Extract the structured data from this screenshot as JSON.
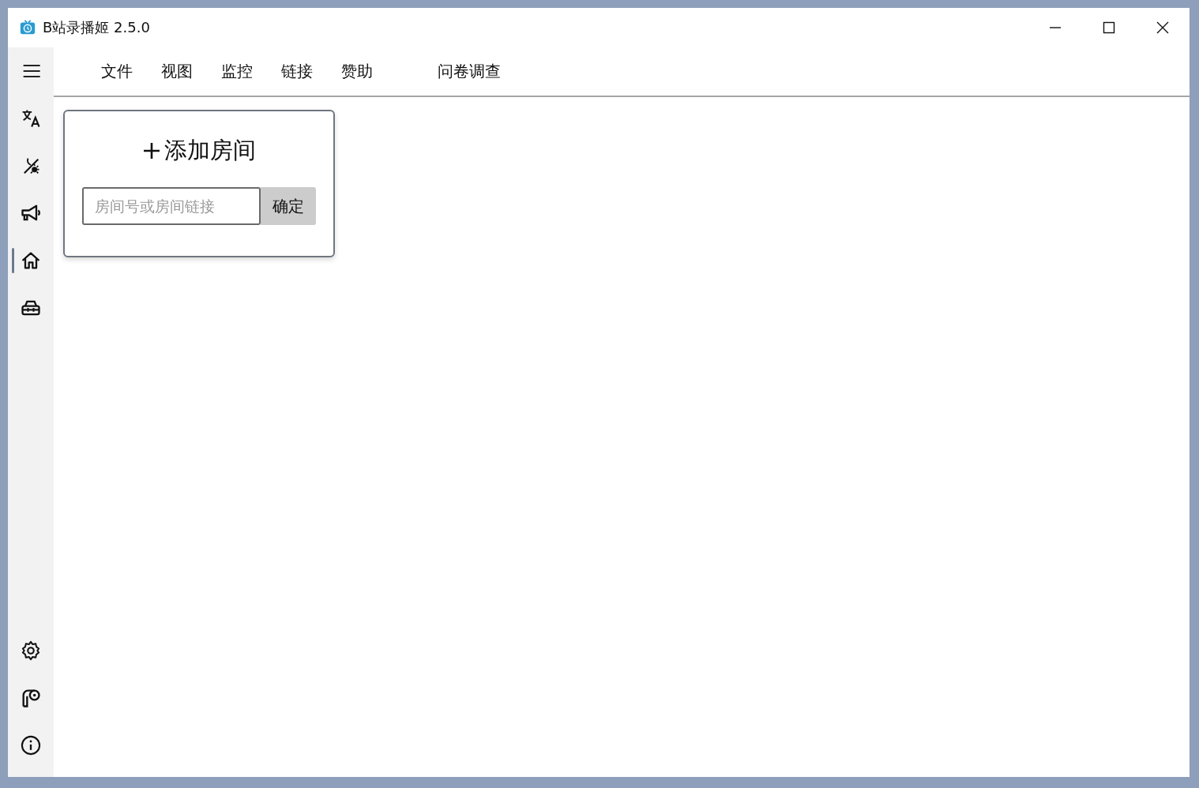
{
  "window": {
    "title": "B站录播姬 2.5.0"
  },
  "sidebar": {
    "top_items": [
      {
        "kind": "menu",
        "selected": false
      },
      {
        "kind": "translate",
        "selected": false
      },
      {
        "kind": "theme",
        "selected": false
      },
      {
        "kind": "announcement",
        "selected": false
      },
      {
        "kind": "home",
        "selected": true
      },
      {
        "kind": "toolbox",
        "selected": false
      }
    ],
    "bottom_items": [
      {
        "kind": "settings",
        "selected": false
      },
      {
        "kind": "paint",
        "selected": false
      },
      {
        "kind": "info",
        "selected": false
      }
    ]
  },
  "menu_bar": [
    "文件",
    "视图",
    "监控",
    "链接",
    "赞助",
    "问卷调查"
  ],
  "add_room_card": {
    "title": "添加房间",
    "field": {
      "placeholder": "房间号或房间链接"
    },
    "button": "确定"
  }
}
